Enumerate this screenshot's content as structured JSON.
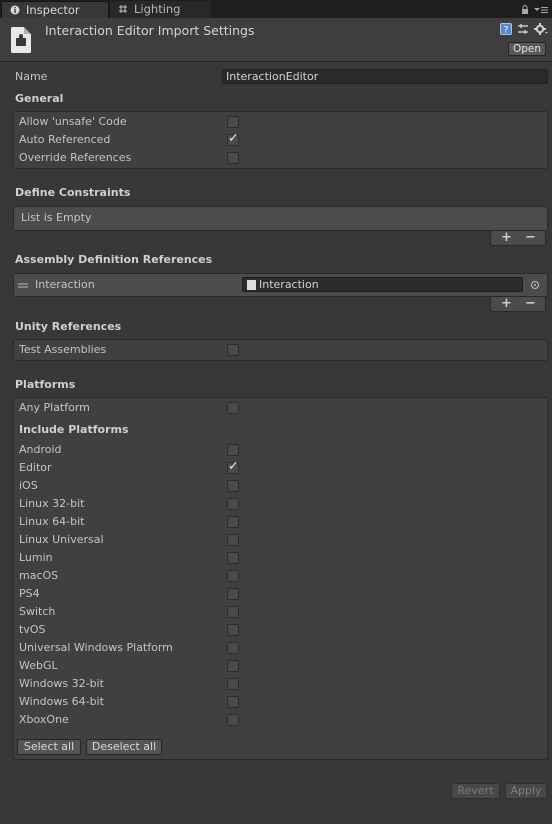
{
  "tabs": {
    "inspector": "Inspector",
    "lighting": "Lighting"
  },
  "header": {
    "title": "Interaction Editor Import Settings",
    "open_label": "Open"
  },
  "name_field": {
    "label": "Name",
    "value": "InteractionEditor"
  },
  "general": {
    "heading": "General",
    "options": [
      {
        "label": "Allow 'unsafe' Code",
        "checked": false
      },
      {
        "label": "Auto Referenced",
        "checked": true
      },
      {
        "label": "Override References",
        "checked": false
      }
    ]
  },
  "define_constraints": {
    "heading": "Define Constraints",
    "empty_text": "List is Empty"
  },
  "assembly_refs": {
    "heading": "Assembly Definition References",
    "items": [
      {
        "label": "Interaction",
        "value": "Interaction"
      }
    ]
  },
  "unity_refs": {
    "heading": "Unity References",
    "test_assemblies": "Test Assemblies"
  },
  "platforms": {
    "heading": "Platforms",
    "any_platform": "Any Platform",
    "include_heading": "Include Platforms",
    "list": [
      {
        "label": "Android",
        "checked": false
      },
      {
        "label": "Editor",
        "checked": true
      },
      {
        "label": "iOS",
        "checked": false
      },
      {
        "label": "Linux 32-bit",
        "checked": false
      },
      {
        "label": "Linux 64-bit",
        "checked": false
      },
      {
        "label": "Linux Universal",
        "checked": false
      },
      {
        "label": "Lumin",
        "checked": false
      },
      {
        "label": "macOS",
        "checked": false
      },
      {
        "label": "PS4",
        "checked": false
      },
      {
        "label": "Switch",
        "checked": false
      },
      {
        "label": "tvOS",
        "checked": false
      },
      {
        "label": "Universal Windows Platform",
        "checked": false
      },
      {
        "label": "WebGL",
        "checked": false
      },
      {
        "label": "Windows 32-bit",
        "checked": false
      },
      {
        "label": "Windows 64-bit",
        "checked": false
      },
      {
        "label": "XboxOne",
        "checked": false
      }
    ],
    "select_all": "Select all",
    "deselect_all": "Deselect all"
  },
  "actions": {
    "revert": "Revert",
    "apply": "Apply"
  },
  "symbols": {
    "check": "✓",
    "plus": "+",
    "minus": "−"
  },
  "colors": {
    "background": "#383838",
    "tab_strip": "#1e1e1e",
    "field": "#2a2a2a",
    "text": "#c4c4c4"
  }
}
